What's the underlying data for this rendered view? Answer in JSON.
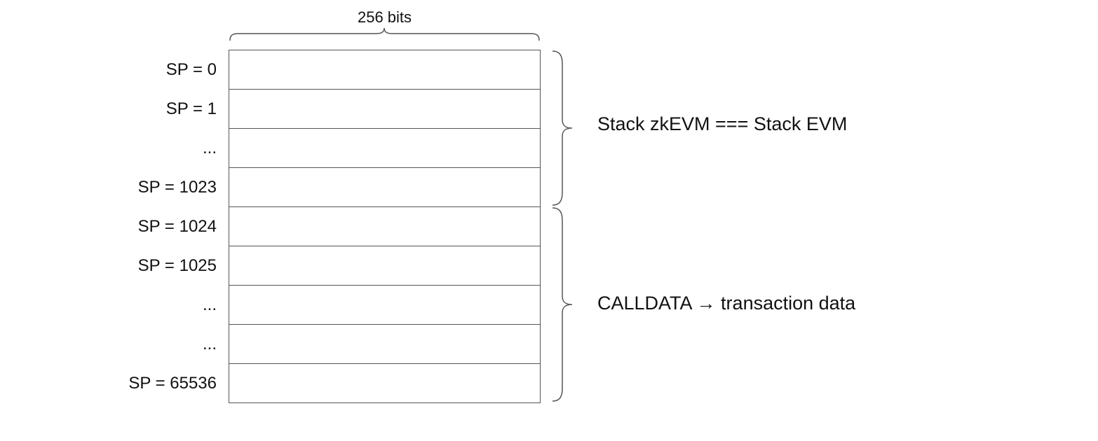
{
  "width_label": "256 bits",
  "rows": {
    "r0": "SP = 0",
    "r1": "SP = 1",
    "r2": "...",
    "r3": "SP = 1023",
    "r4": "SP = 1024",
    "r5": "SP = 1025",
    "r6": "...",
    "r7": "...",
    "r8": "SP = 65536"
  },
  "annotations": {
    "top": "Stack zkEVM === Stack EVM",
    "bottom": "CALLDATA → transaction data"
  }
}
